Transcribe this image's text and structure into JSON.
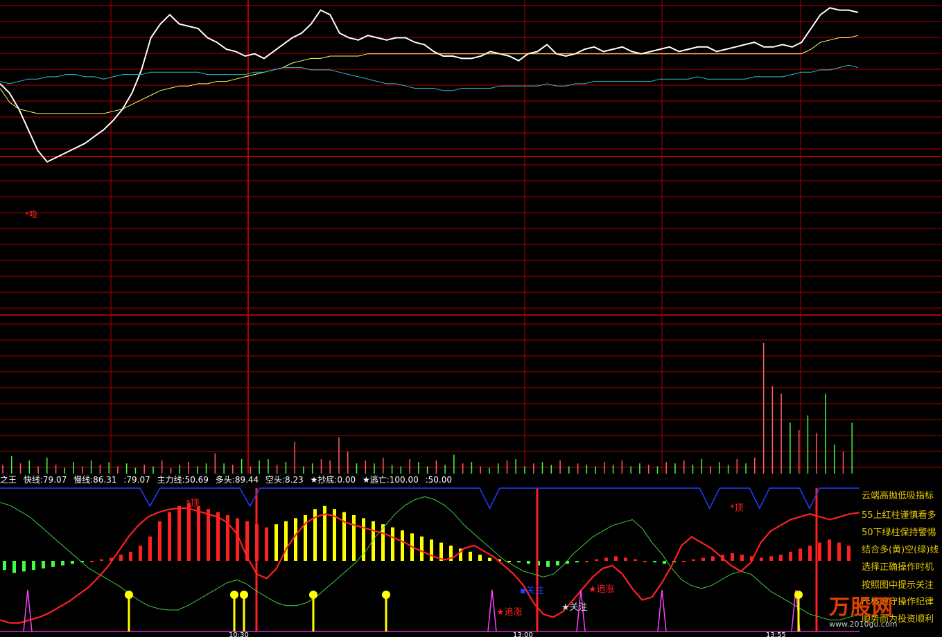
{
  "header": {
    "name": "之王",
    "items": [
      "快线:79.07",
      "慢线:86.31",
      ":79.07",
      "主力线:50.69",
      "多头:89.44",
      "空头:8.23",
      "★抄底:0.00",
      "★逃亡:100.00",
      ":50.00"
    ]
  },
  "side_notes": [
    "云端高抛低吸指标",
    "55上红柱谨慎看多",
    "50下绿柱保持警惕",
    "结合多(黄)空(绿)线",
    "选择正确操作时机",
    "按照图中提示关注",
    "严格遵守操作纪律",
    "顺势而为投资顺利"
  ],
  "chart_labels": {
    "buy": "吸",
    "top": "顶",
    "focus": "关注",
    "chase": "追涨"
  },
  "logo": {
    "name": "万股网",
    "url": "www.2010gu.com"
  },
  "time_ticks": [
    "10:30",
    "13:00",
    "13:55"
  ],
  "colors": {
    "background": "#000000",
    "grid": "#b00000",
    "price": "#ffffff",
    "avg": "#ffff66",
    "cyan": "#33bbcc",
    "up_volume": "#ff6060",
    "down_volume": "#40ff40",
    "red_line": "#ff2020",
    "green_line": "#40d040",
    "blue_line": "#2040ff",
    "yellow_bar": "#ffff00",
    "magenta": "#ff40ff"
  },
  "chart_data": [
    {
      "type": "line",
      "panel": "price",
      "series": [
        {
          "key": "price",
          "values": [
            0.66,
            0.62,
            0.55,
            0.46,
            0.37,
            0.32,
            0.34,
            0.36,
            0.38,
            0.4,
            0.43,
            0.46,
            0.5,
            0.55,
            0.62,
            0.72,
            0.86,
            0.92,
            0.96,
            0.92,
            0.91,
            0.9,
            0.86,
            0.84,
            0.81,
            0.8,
            0.78,
            0.79,
            0.77,
            0.8,
            0.83,
            0.86,
            0.88,
            0.92,
            0.98,
            0.96,
            0.88,
            0.86,
            0.85,
            0.87,
            0.86,
            0.85,
            0.86,
            0.86,
            0.84,
            0.83,
            0.8,
            0.78,
            0.78,
            0.77,
            0.77,
            0.78,
            0.8,
            0.79,
            0.78,
            0.76,
            0.79,
            0.8,
            0.83,
            0.79,
            0.78,
            0.79,
            0.81,
            0.82,
            0.8,
            0.81,
            0.82,
            0.8,
            0.79,
            0.8,
            0.81,
            0.82,
            0.8,
            0.81,
            0.82,
            0.82,
            0.8,
            0.81,
            0.82,
            0.83,
            0.84,
            0.82,
            0.82,
            0.83,
            0.82,
            0.84,
            0.9,
            0.96,
            0.99,
            0.98,
            0.98,
            0.97
          ]
        },
        {
          "key": "avg",
          "values": [
            0.64,
            0.58,
            0.55,
            0.54,
            0.53,
            0.53,
            0.53,
            0.53,
            0.53,
            0.53,
            0.53,
            0.53,
            0.54,
            0.55,
            0.57,
            0.59,
            0.61,
            0.63,
            0.64,
            0.65,
            0.65,
            0.66,
            0.66,
            0.67,
            0.67,
            0.68,
            0.69,
            0.7,
            0.71,
            0.72,
            0.73,
            0.75,
            0.76,
            0.77,
            0.77,
            0.78,
            0.78,
            0.78,
            0.78,
            0.79,
            0.79,
            0.79,
            0.79,
            0.79,
            0.79,
            0.79,
            0.79,
            0.79,
            0.79,
            0.79,
            0.79,
            0.79,
            0.79,
            0.79,
            0.79,
            0.79,
            0.79,
            0.79,
            0.79,
            0.79,
            0.79,
            0.79,
            0.79,
            0.79,
            0.79,
            0.79,
            0.79,
            0.79,
            0.79,
            0.79,
            0.79,
            0.79,
            0.79,
            0.79,
            0.79,
            0.79,
            0.79,
            0.79,
            0.79,
            0.79,
            0.79,
            0.79,
            0.79,
            0.79,
            0.79,
            0.79,
            0.81,
            0.84,
            0.85,
            0.86,
            0.86,
            0.87
          ]
        },
        {
          "key": "cyan",
          "values": [
            0.67,
            0.66,
            0.67,
            0.68,
            0.68,
            0.69,
            0.69,
            0.7,
            0.7,
            0.69,
            0.69,
            0.68,
            0.69,
            0.7,
            0.7,
            0.7,
            0.71,
            0.71,
            0.71,
            0.71,
            0.71,
            0.71,
            0.7,
            0.7,
            0.7,
            0.7,
            0.7,
            0.71,
            0.71,
            0.72,
            0.73,
            0.73,
            0.73,
            0.72,
            0.72,
            0.72,
            0.71,
            0.7,
            0.69,
            0.68,
            0.67,
            0.66,
            0.66,
            0.65,
            0.64,
            0.64,
            0.64,
            0.63,
            0.63,
            0.64,
            0.64,
            0.64,
            0.64,
            0.65,
            0.65,
            0.65,
            0.65,
            0.65,
            0.66,
            0.65,
            0.65,
            0.66,
            0.66,
            0.67,
            0.67,
            0.67,
            0.67,
            0.67,
            0.67,
            0.67,
            0.68,
            0.68,
            0.68,
            0.68,
            0.69,
            0.68,
            0.68,
            0.68,
            0.68,
            0.68,
            0.69,
            0.69,
            0.69,
            0.69,
            0.7,
            0.71,
            0.71,
            0.72,
            0.72,
            0.73,
            0.74,
            0.73
          ]
        }
      ]
    },
    {
      "type": "bar",
      "panel": "volume",
      "values": [
        0.06,
        0.12,
        0.07,
        0.09,
        0.05,
        0.11,
        0.06,
        0.04,
        0.08,
        0.05,
        0.09,
        0.06,
        0.08,
        0.05,
        0.07,
        0.04,
        0.06,
        0.05,
        0.09,
        0.04,
        0.06,
        0.08,
        0.05,
        0.07,
        0.14,
        0.07,
        0.06,
        0.1,
        0.05,
        0.09,
        0.1,
        0.06,
        0.08,
        0.22,
        0.05,
        0.07,
        0.1,
        0.09,
        0.25,
        0.15,
        0.07,
        0.09,
        0.07,
        0.11,
        0.06,
        0.05,
        0.1,
        0.08,
        0.05,
        0.09,
        0.06,
        0.13,
        0.07,
        0.08,
        0.05,
        0.04,
        0.07,
        0.09,
        0.1,
        0.05,
        0.07,
        0.08,
        0.06,
        0.09,
        0.05,
        0.07,
        0.06,
        0.05,
        0.08,
        0.06,
        0.09,
        0.05,
        0.07,
        0.06,
        0.05,
        0.08,
        0.07,
        0.09,
        0.06,
        0.1,
        0.05,
        0.08,
        0.06,
        0.1,
        0.07,
        0.11,
        0.9,
        0.6,
        0.55,
        0.35,
        0.3,
        0.4,
        0.28,
        0.55,
        0.2,
        0.15,
        0.35
      ],
      "up": [
        1,
        0,
        1,
        0,
        1,
        0,
        1,
        0,
        0,
        1,
        0,
        1,
        0,
        1,
        0,
        0,
        1,
        0,
        1,
        1,
        0,
        1,
        0,
        0,
        1,
        0,
        1,
        0,
        1,
        0,
        0,
        1,
        0,
        1,
        0,
        0,
        1,
        1,
        1,
        1,
        0,
        1,
        0,
        1,
        0,
        0,
        1,
        0,
        0,
        1,
        0,
        0,
        1,
        0,
        1,
        0,
        0,
        1,
        0,
        0,
        1,
        0,
        0,
        1,
        0,
        1,
        0,
        0,
        1,
        0,
        1,
        0,
        0,
        1,
        0,
        1,
        0,
        1,
        0,
        0,
        1,
        0,
        0,
        1,
        0,
        1,
        1,
        1,
        1,
        0,
        1,
        0,
        1,
        0,
        0,
        1,
        0
      ]
    },
    {
      "type": "mixed",
      "panel": "indicator",
      "ylim": [
        0,
        100
      ],
      "red_line": [
        8,
        6,
        6,
        8,
        10,
        13,
        17,
        21,
        26,
        31,
        38,
        46,
        56,
        66,
        74,
        80,
        83,
        85,
        86,
        86,
        84,
        82,
        80,
        76,
        68,
        52,
        40,
        37,
        44,
        58,
        68,
        76,
        80,
        82,
        80,
        76,
        74,
        72,
        70,
        68,
        65,
        62,
        58,
        55,
        52,
        50,
        52,
        58,
        60,
        56,
        52,
        46,
        40,
        32,
        20,
        12,
        10,
        14,
        22,
        30,
        38,
        44,
        46,
        40,
        30,
        22,
        24,
        34,
        46,
        60,
        66,
        62,
        58,
        52,
        46,
        42,
        48,
        62,
        70,
        74,
        78,
        80,
        82,
        80,
        78,
        80,
        82,
        83
      ],
      "green_line": [
        90,
        88,
        84,
        80,
        74,
        68,
        62,
        56,
        50,
        44,
        40,
        36,
        32,
        27,
        22,
        18,
        16,
        15,
        15,
        18,
        22,
        26,
        30,
        34,
        36,
        33,
        28,
        24,
        20,
        18,
        18,
        20,
        24,
        30,
        36,
        42,
        48,
        56,
        66,
        74,
        82,
        88,
        92,
        94,
        92,
        88,
        82,
        74,
        68,
        62,
        56,
        50,
        46,
        42,
        40,
        38,
        40,
        46,
        54,
        60,
        66,
        70,
        74,
        76,
        78,
        72,
        62,
        54,
        44,
        36,
        32,
        30,
        32,
        36,
        40,
        42,
        40,
        34,
        28,
        24,
        20,
        16,
        12,
        10,
        8,
        8,
        10,
        12
      ],
      "blue_line": [
        100,
        100,
        100,
        100,
        100,
        100,
        100,
        100,
        100,
        100,
        100,
        100,
        100,
        100,
        100,
        60,
        100,
        100,
        100,
        100,
        100,
        100,
        100,
        100,
        100,
        60,
        100,
        100,
        100,
        100,
        100,
        100,
        100,
        100,
        100,
        100,
        100,
        100,
        100,
        100,
        100,
        100,
        100,
        100,
        100,
        100,
        100,
        100,
        100,
        55,
        100,
        100,
        100,
        100,
        100,
        100,
        100,
        100,
        100,
        100,
        100,
        100,
        100,
        100,
        100,
        100,
        100,
        100,
        100,
        100,
        100,
        55,
        100,
        100,
        100,
        100,
        55,
        100,
        100,
        100,
        100,
        55,
        100,
        100,
        100,
        100,
        100
      ],
      "histogram": [
        -6,
        -8,
        -7,
        -6,
        -5,
        -4,
        -3,
        -2,
        -1,
        0,
        1,
        2,
        4,
        6,
        10,
        16,
        26,
        32,
        36,
        38,
        36,
        34,
        32,
        30,
        28,
        26,
        24,
        22,
        24,
        26,
        28,
        30,
        34,
        36,
        34,
        32,
        30,
        28,
        26,
        24,
        22,
        20,
        18,
        16,
        14,
        12,
        10,
        8,
        6,
        4,
        2,
        1,
        0,
        -1,
        -2,
        -3,
        -4,
        -3,
        -2,
        -1,
        0,
        1,
        2,
        3,
        2,
        1,
        0,
        -1,
        -2,
        -1,
        0,
        1,
        2,
        3,
        4,
        5,
        4,
        3,
        2,
        3,
        4,
        6,
        8,
        10,
        12,
        14,
        12,
        10
      ],
      "stars": [
        {
          "label": "chase",
          "x": 0.585
        },
        {
          "label": "focus",
          "x": 0.605
        },
        {
          "label": "chase",
          "x": 0.68
        }
      ]
    }
  ]
}
